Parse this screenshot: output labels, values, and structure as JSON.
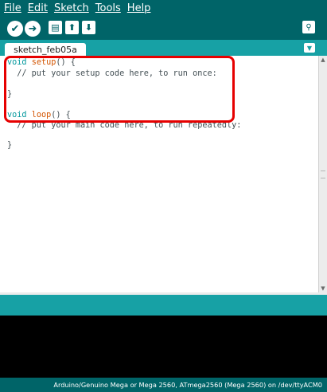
{
  "menu": {
    "items": [
      "File",
      "Edit",
      "Sketch",
      "Tools",
      "Help"
    ]
  },
  "toolbar": {
    "verify_icon": "checkmark-icon",
    "upload_icon": "arrow-right-icon",
    "new_icon": "new-file-icon",
    "open_icon": "arrow-up-icon",
    "save_icon": "arrow-down-icon",
    "serial_icon": "magnifier-icon"
  },
  "tab": {
    "label": "sketch_feb05a"
  },
  "code": {
    "l1_kw": "void",
    "l1_fn": "setup",
    "l1_rest": "() {",
    "l2": "  // put your setup code here, to run once:",
    "l4": "}",
    "l6_kw": "void",
    "l6_fn": "loop",
    "l6_rest": "() {",
    "l7": "  // put your main code here, to run repeatedly:",
    "l9": "}"
  },
  "footer": {
    "board": "Arduino/Genuino Mega or Mega 2560, ATmega2560 (Mega 2560) on /dev/ttyACM0"
  },
  "colors": {
    "dark_teal": "#006468",
    "teal": "#17a1a5",
    "highlight": "#e60000"
  }
}
